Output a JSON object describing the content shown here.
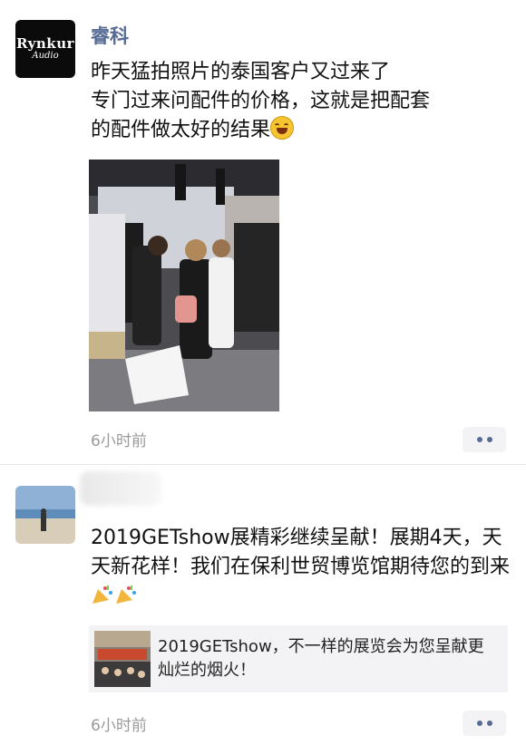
{
  "posts": [
    {
      "author_logo": {
        "brand": "Rynkur",
        "sub": "Audio"
      },
      "username": "睿科",
      "text": "昨天猛拍照片的泰国客户又过来了\n专门过来问配件的价格，这就是把配套\n的配件做太好的结果",
      "emoji": "laughing-tears-emoji",
      "time": "6小时前"
    },
    {
      "username": "",
      "text": "2019GETshow展精彩继续呈献！展期4天，天天新花样！我们在保利世贸博览馆期待您的到来",
      "emoji": "party-popper-emoji",
      "link_card": {
        "title": "2019GETshow，不一样的展览会为您呈献更灿烂的烟火！"
      },
      "time": "6小时前"
    }
  ],
  "colors": {
    "username": "#576b95",
    "time": "#9a9a9a",
    "card_bg": "#f3f3f5"
  }
}
